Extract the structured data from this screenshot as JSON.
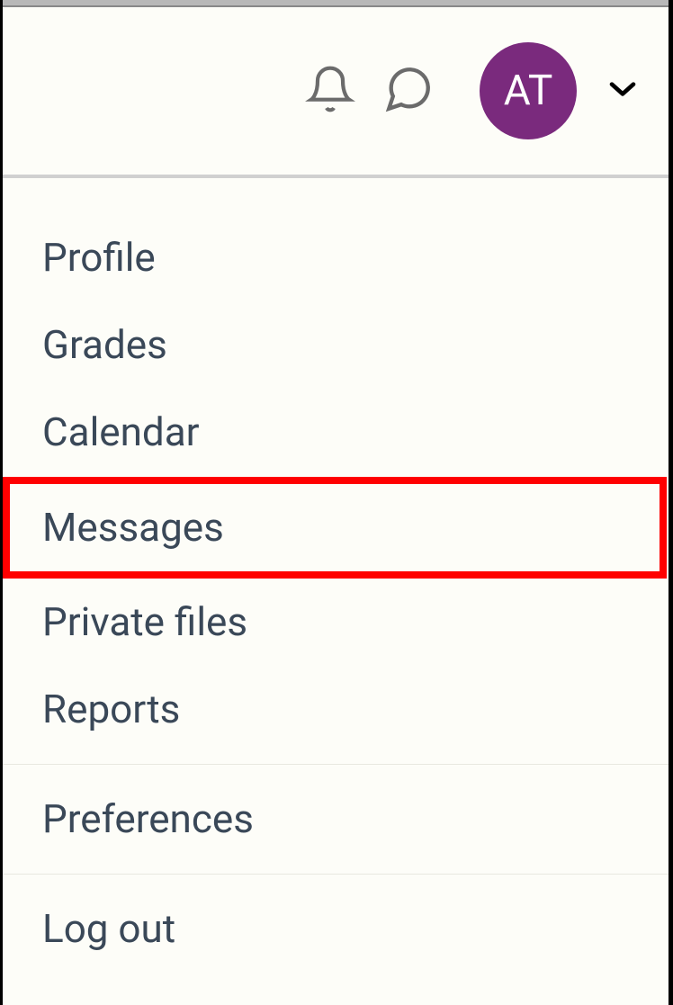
{
  "header": {
    "avatar_initials": "AT"
  },
  "menu": {
    "items": [
      {
        "label": "Profile"
      },
      {
        "label": "Grades"
      },
      {
        "label": "Calendar"
      },
      {
        "label": "Messages"
      },
      {
        "label": "Private files"
      },
      {
        "label": "Reports"
      }
    ],
    "section2": [
      {
        "label": "Preferences"
      }
    ],
    "section3": [
      {
        "label": "Log out"
      }
    ]
  }
}
